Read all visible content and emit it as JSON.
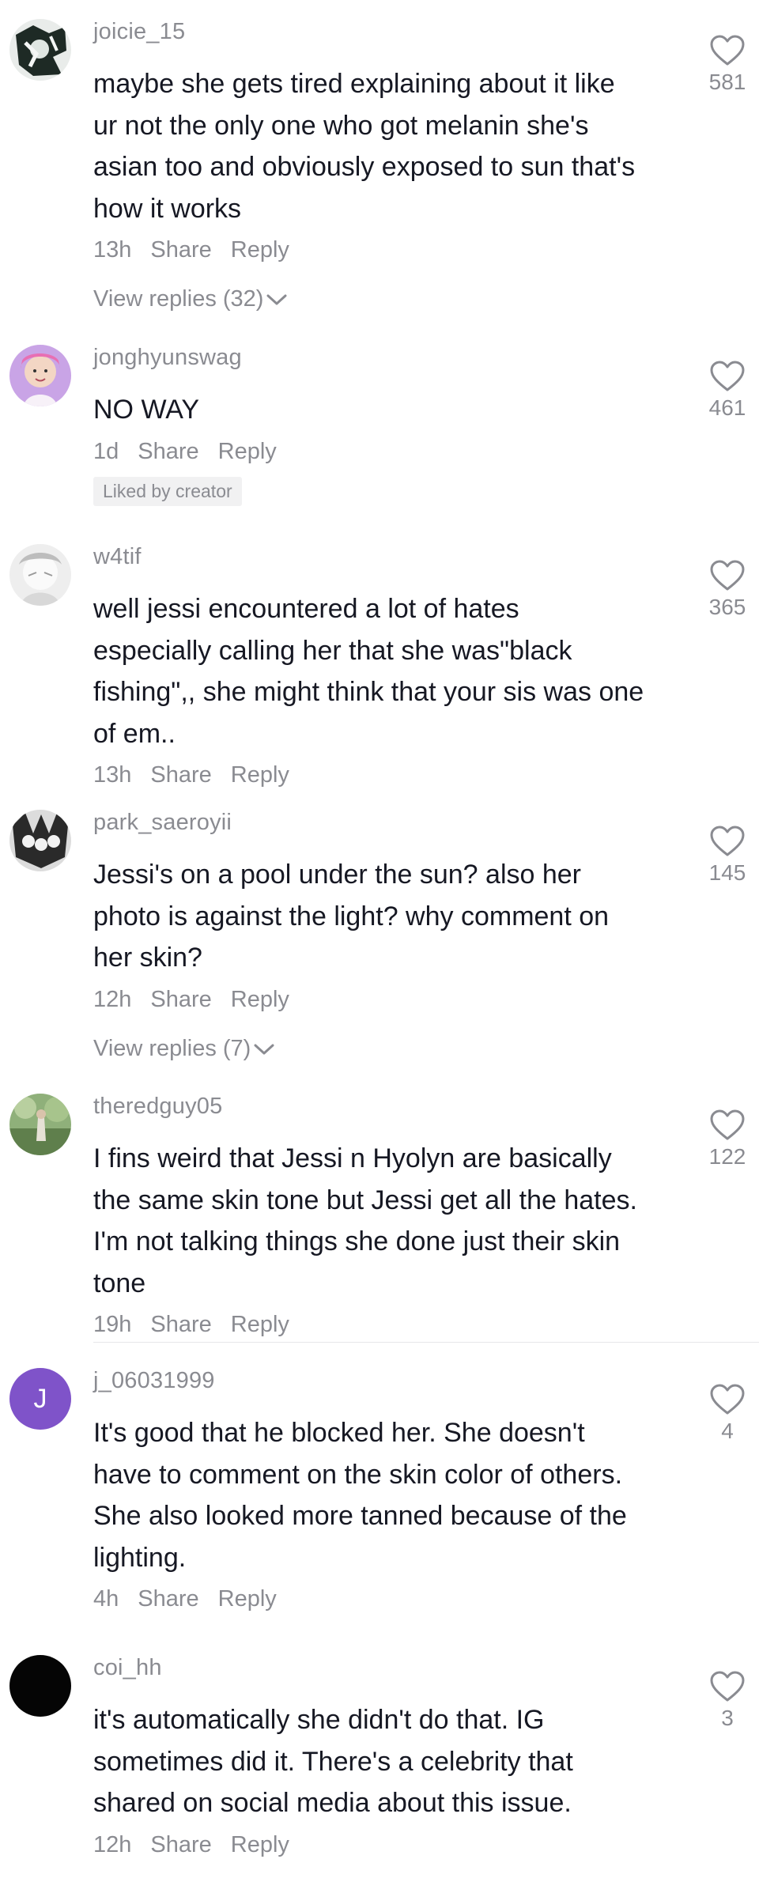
{
  "comments": [
    {
      "username": "joicie_15",
      "lines": [
        "maybe she gets tired explaining about it like",
        "ur not the only one who got melanin she's",
        "asian too and obviously exposed to sun that's",
        "how it works"
      ],
      "time": "13h",
      "share": "Share",
      "reply": "Reply",
      "likes": "581",
      "view_replies": "View replies (32)"
    },
    {
      "username": "jonghyunswag",
      "lines": [
        "NO WAY"
      ],
      "time": "1d",
      "share": "Share",
      "reply": "Reply",
      "likes": "461",
      "badge": "Liked by creator"
    },
    {
      "username": "w4tif",
      "lines": [
        "well jessi encountered a lot of hates",
        "especially calling her that she was\"black",
        "fishing\",, she might think that your sis was one",
        "of em.."
      ],
      "time": "13h",
      "share": "Share",
      "reply": "Reply",
      "likes": "365"
    },
    {
      "username": "park_saeroyii",
      "lines": [
        "Jessi's on a pool under the sun? also her",
        "photo is against the light? why comment on",
        "her skin?"
      ],
      "time": "12h",
      "share": "Share",
      "reply": "Reply",
      "likes": "145",
      "view_replies": "View replies (7)"
    },
    {
      "username": "theredguy05",
      "lines": [
        "I fins weird that Jessi n Hyolyn are basically",
        "the same skin tone but Jessi get all the hates.",
        "I'm not talking things she done just their skin",
        "tone"
      ],
      "time": "19h",
      "share": "Share",
      "reply": "Reply",
      "likes": "122"
    },
    {
      "username": "j_06031999",
      "avatar_letter": "J",
      "lines": [
        "It's good that he blocked her. She doesn't",
        "have to comment on the skin color of others.",
        "She also looked more tanned because of the",
        "lighting."
      ],
      "time": "4h",
      "share": "Share",
      "reply": "Reply",
      "likes": "4"
    },
    {
      "username": "coi_hh",
      "lines": [
        "it's automatically she didn't do that. IG",
        "sometimes did it. There's a celebrity that",
        "shared on social media about this issue."
      ],
      "time": "12h",
      "share": "Share",
      "reply": "Reply",
      "likes": "3"
    }
  ],
  "colors": {
    "text": "#161823",
    "secondary": "#8a8b91",
    "avatar_letter_bg": "#7f53c9"
  },
  "icons": {
    "like": "heart-outline-icon",
    "expand": "chevron-down-icon"
  }
}
